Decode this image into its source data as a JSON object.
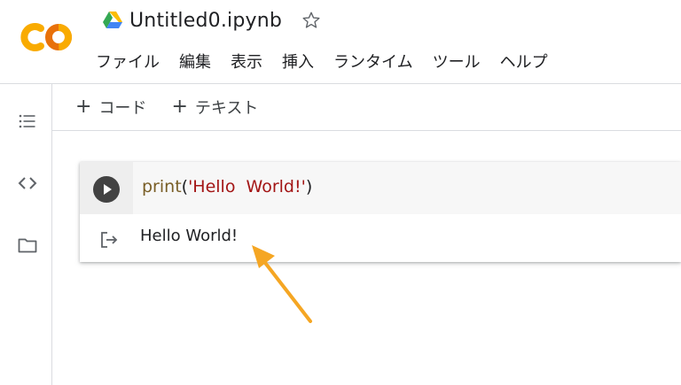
{
  "header": {
    "logo_text": "CO",
    "title": "Untitled0.ipynb",
    "menu": [
      "ファイル",
      "編集",
      "表示",
      "挿入",
      "ランタイム",
      "ツール",
      "ヘルプ"
    ]
  },
  "toolbar": {
    "add_code": "コード",
    "add_text": "テキスト"
  },
  "cell": {
    "code_func": "print",
    "code_open": "(",
    "code_string": "'Hello  World!'",
    "code_close": ")",
    "output": "Hello World!"
  },
  "colors": {
    "logo_orange": "#f9ab00",
    "logo_dark_orange": "#e8710a",
    "arrow": "#f5a623"
  },
  "icons": [
    "drive-icon",
    "star-icon",
    "table-of-contents-icon",
    "code-snippets-icon",
    "folder-icon",
    "run-icon",
    "output-redirect-icon",
    "annotation-arrow"
  ]
}
